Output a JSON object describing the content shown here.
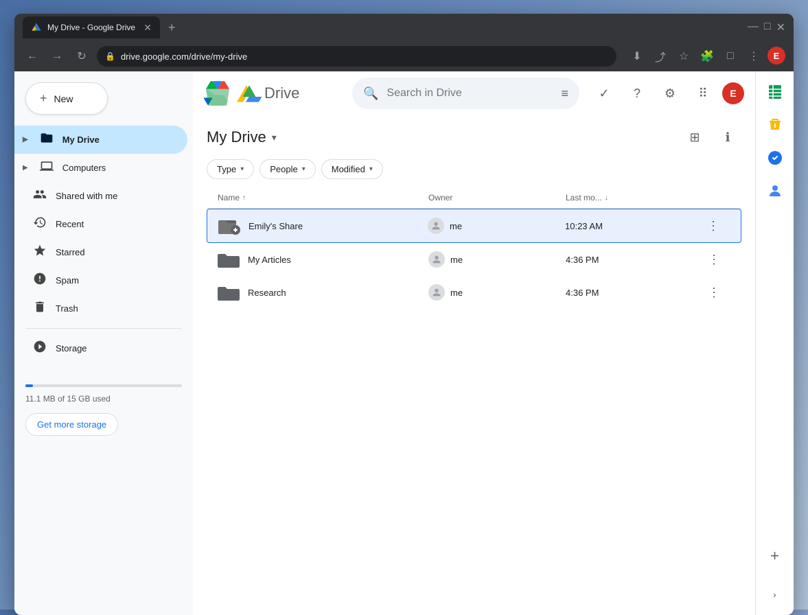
{
  "browser": {
    "tab_title": "My Drive - Google Drive",
    "url": "drive.google.com/drive/my-drive",
    "new_tab_label": "+",
    "win_minimize": "—",
    "win_maximize": "□",
    "win_close": "✕"
  },
  "header": {
    "app_name": "Drive",
    "search_placeholder": "Search in Drive",
    "user_initial": "E"
  },
  "sidebar": {
    "new_button": "New",
    "items": [
      {
        "id": "my-drive",
        "label": "My Drive",
        "active": true
      },
      {
        "id": "computers",
        "label": "Computers",
        "active": false
      },
      {
        "id": "shared-with-me",
        "label": "Shared with me",
        "active": false
      },
      {
        "id": "recent",
        "label": "Recent",
        "active": false
      },
      {
        "id": "starred",
        "label": "Starred",
        "active": false
      },
      {
        "id": "spam",
        "label": "Spam",
        "active": false
      },
      {
        "id": "trash",
        "label": "Trash",
        "active": false
      },
      {
        "id": "storage",
        "label": "Storage",
        "active": false
      }
    ],
    "storage_text": "11.1 MB of 15 GB used",
    "get_storage_label": "Get more storage"
  },
  "content": {
    "page_title": "My Drive",
    "filters": [
      {
        "id": "type",
        "label": "Type"
      },
      {
        "id": "people",
        "label": "People"
      },
      {
        "id": "modified",
        "label": "Modified"
      }
    ],
    "columns": [
      {
        "id": "name",
        "label": "Name",
        "sortable": true
      },
      {
        "id": "owner",
        "label": "Owner",
        "sortable": false
      },
      {
        "id": "last_modified",
        "label": "Last mo...",
        "sortable": true,
        "active_sort": true
      }
    ],
    "files": [
      {
        "id": "emilys-share",
        "name": "Emily's Share",
        "type": "shared-folder",
        "owner": "me",
        "modified": "10:23 AM",
        "selected": true
      },
      {
        "id": "my-articles",
        "name": "My Articles",
        "type": "folder",
        "owner": "me",
        "modified": "4:36 PM",
        "selected": false
      },
      {
        "id": "research",
        "name": "Research",
        "type": "folder",
        "owner": "me",
        "modified": "4:36 PM",
        "selected": false
      }
    ]
  },
  "right_sidebar": {
    "icons": [
      {
        "id": "sheets",
        "symbol": "▦"
      },
      {
        "id": "keep",
        "symbol": "◆"
      },
      {
        "id": "tasks",
        "symbol": "✓"
      },
      {
        "id": "contacts",
        "symbol": "👤"
      }
    ]
  }
}
